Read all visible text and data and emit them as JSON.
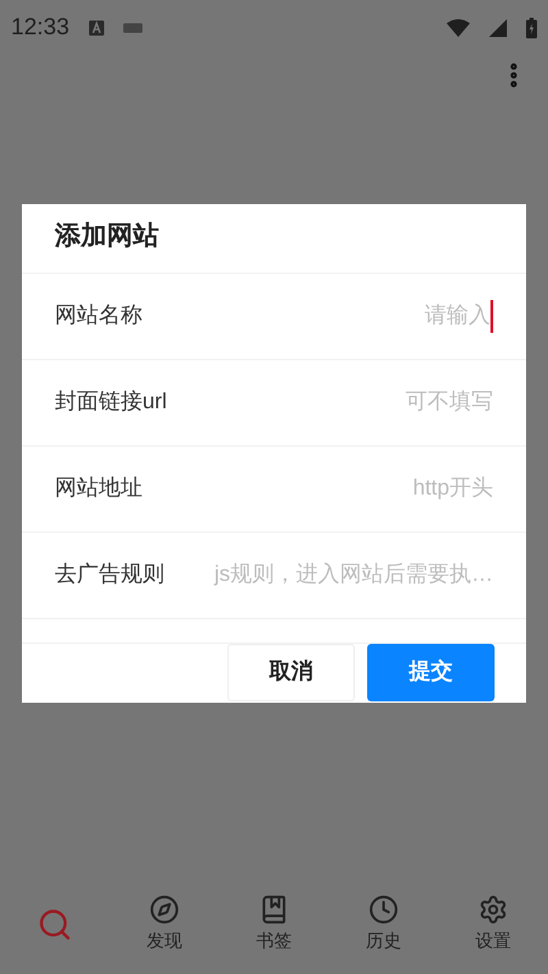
{
  "status_bar": {
    "time": "12:33"
  },
  "dialog": {
    "title": "添加网站",
    "fields": [
      {
        "label": "网站名称",
        "placeholder": "请输入",
        "focused": true
      },
      {
        "label": "封面链接url",
        "placeholder": "可不填写",
        "focused": false
      },
      {
        "label": "网站地址",
        "placeholder": "http开头",
        "focused": false
      },
      {
        "label": "去广告规则",
        "placeholder": "js规则，进入网站后需要执…",
        "focused": false
      }
    ],
    "buttons": [
      {
        "label": "取消",
        "kind": "secondary"
      },
      {
        "label": "提交",
        "kind": "primary"
      }
    ]
  },
  "bottom_nav": [
    {
      "selected": true
    },
    {
      "label": "发现",
      "selected": false
    },
    {
      "label": "书签",
      "selected": false
    },
    {
      "label": "历史",
      "selected": false
    },
    {
      "label": "设置",
      "selected": false
    }
  ]
}
